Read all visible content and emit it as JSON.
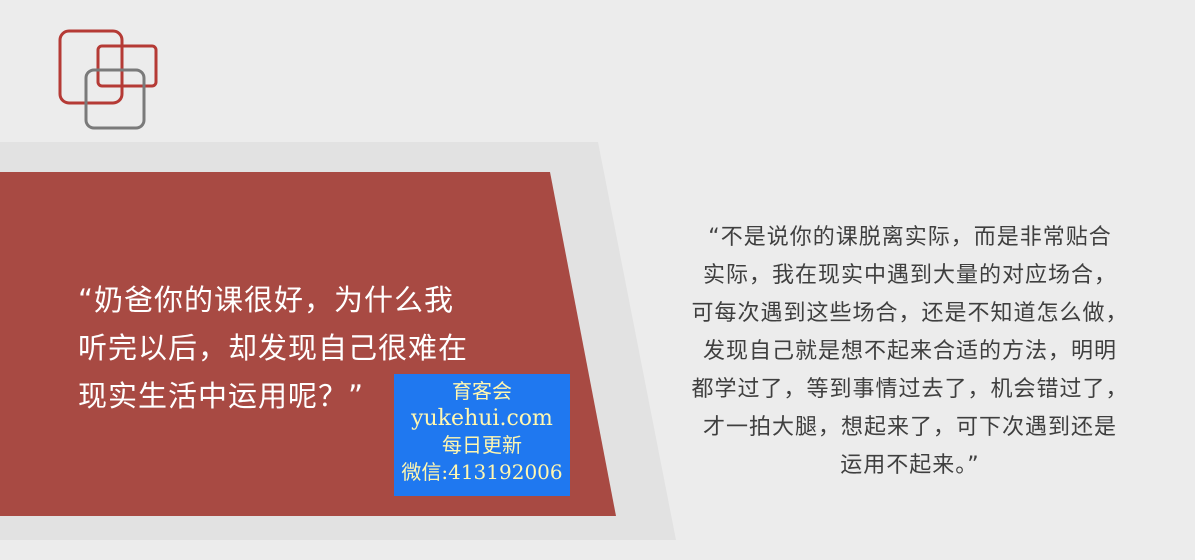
{
  "slide": {
    "left_quote": "“奶爸你的课很好，为什么我\n听完以后，却发现自己很难在\n现实生活中运用呢？”",
    "right_quote_lines": [
      "“不是说你的课脱离实际，而是非常贴合",
      "实际，我在现实中遇到大量的对应场合，",
      "可每次遇到这些场合，还是不知道怎么做，",
      "发现自己就是想不起来合适的方法，明明",
      "都学过了，等到事情过去了，机会错过了，",
      "才一拍大腿，想起来了，可下次遇到还是",
      "运用不起来。”"
    ]
  },
  "watermark": {
    "line1": "育客会",
    "line2": "yukehui.com",
    "line3": "每日更新",
    "line4": "微信:413192006"
  },
  "colors": {
    "accent_red": "#a84a43",
    "background": "#ececec",
    "watermark_blue": "#1f78f0",
    "watermark_text": "#fff7b0"
  }
}
